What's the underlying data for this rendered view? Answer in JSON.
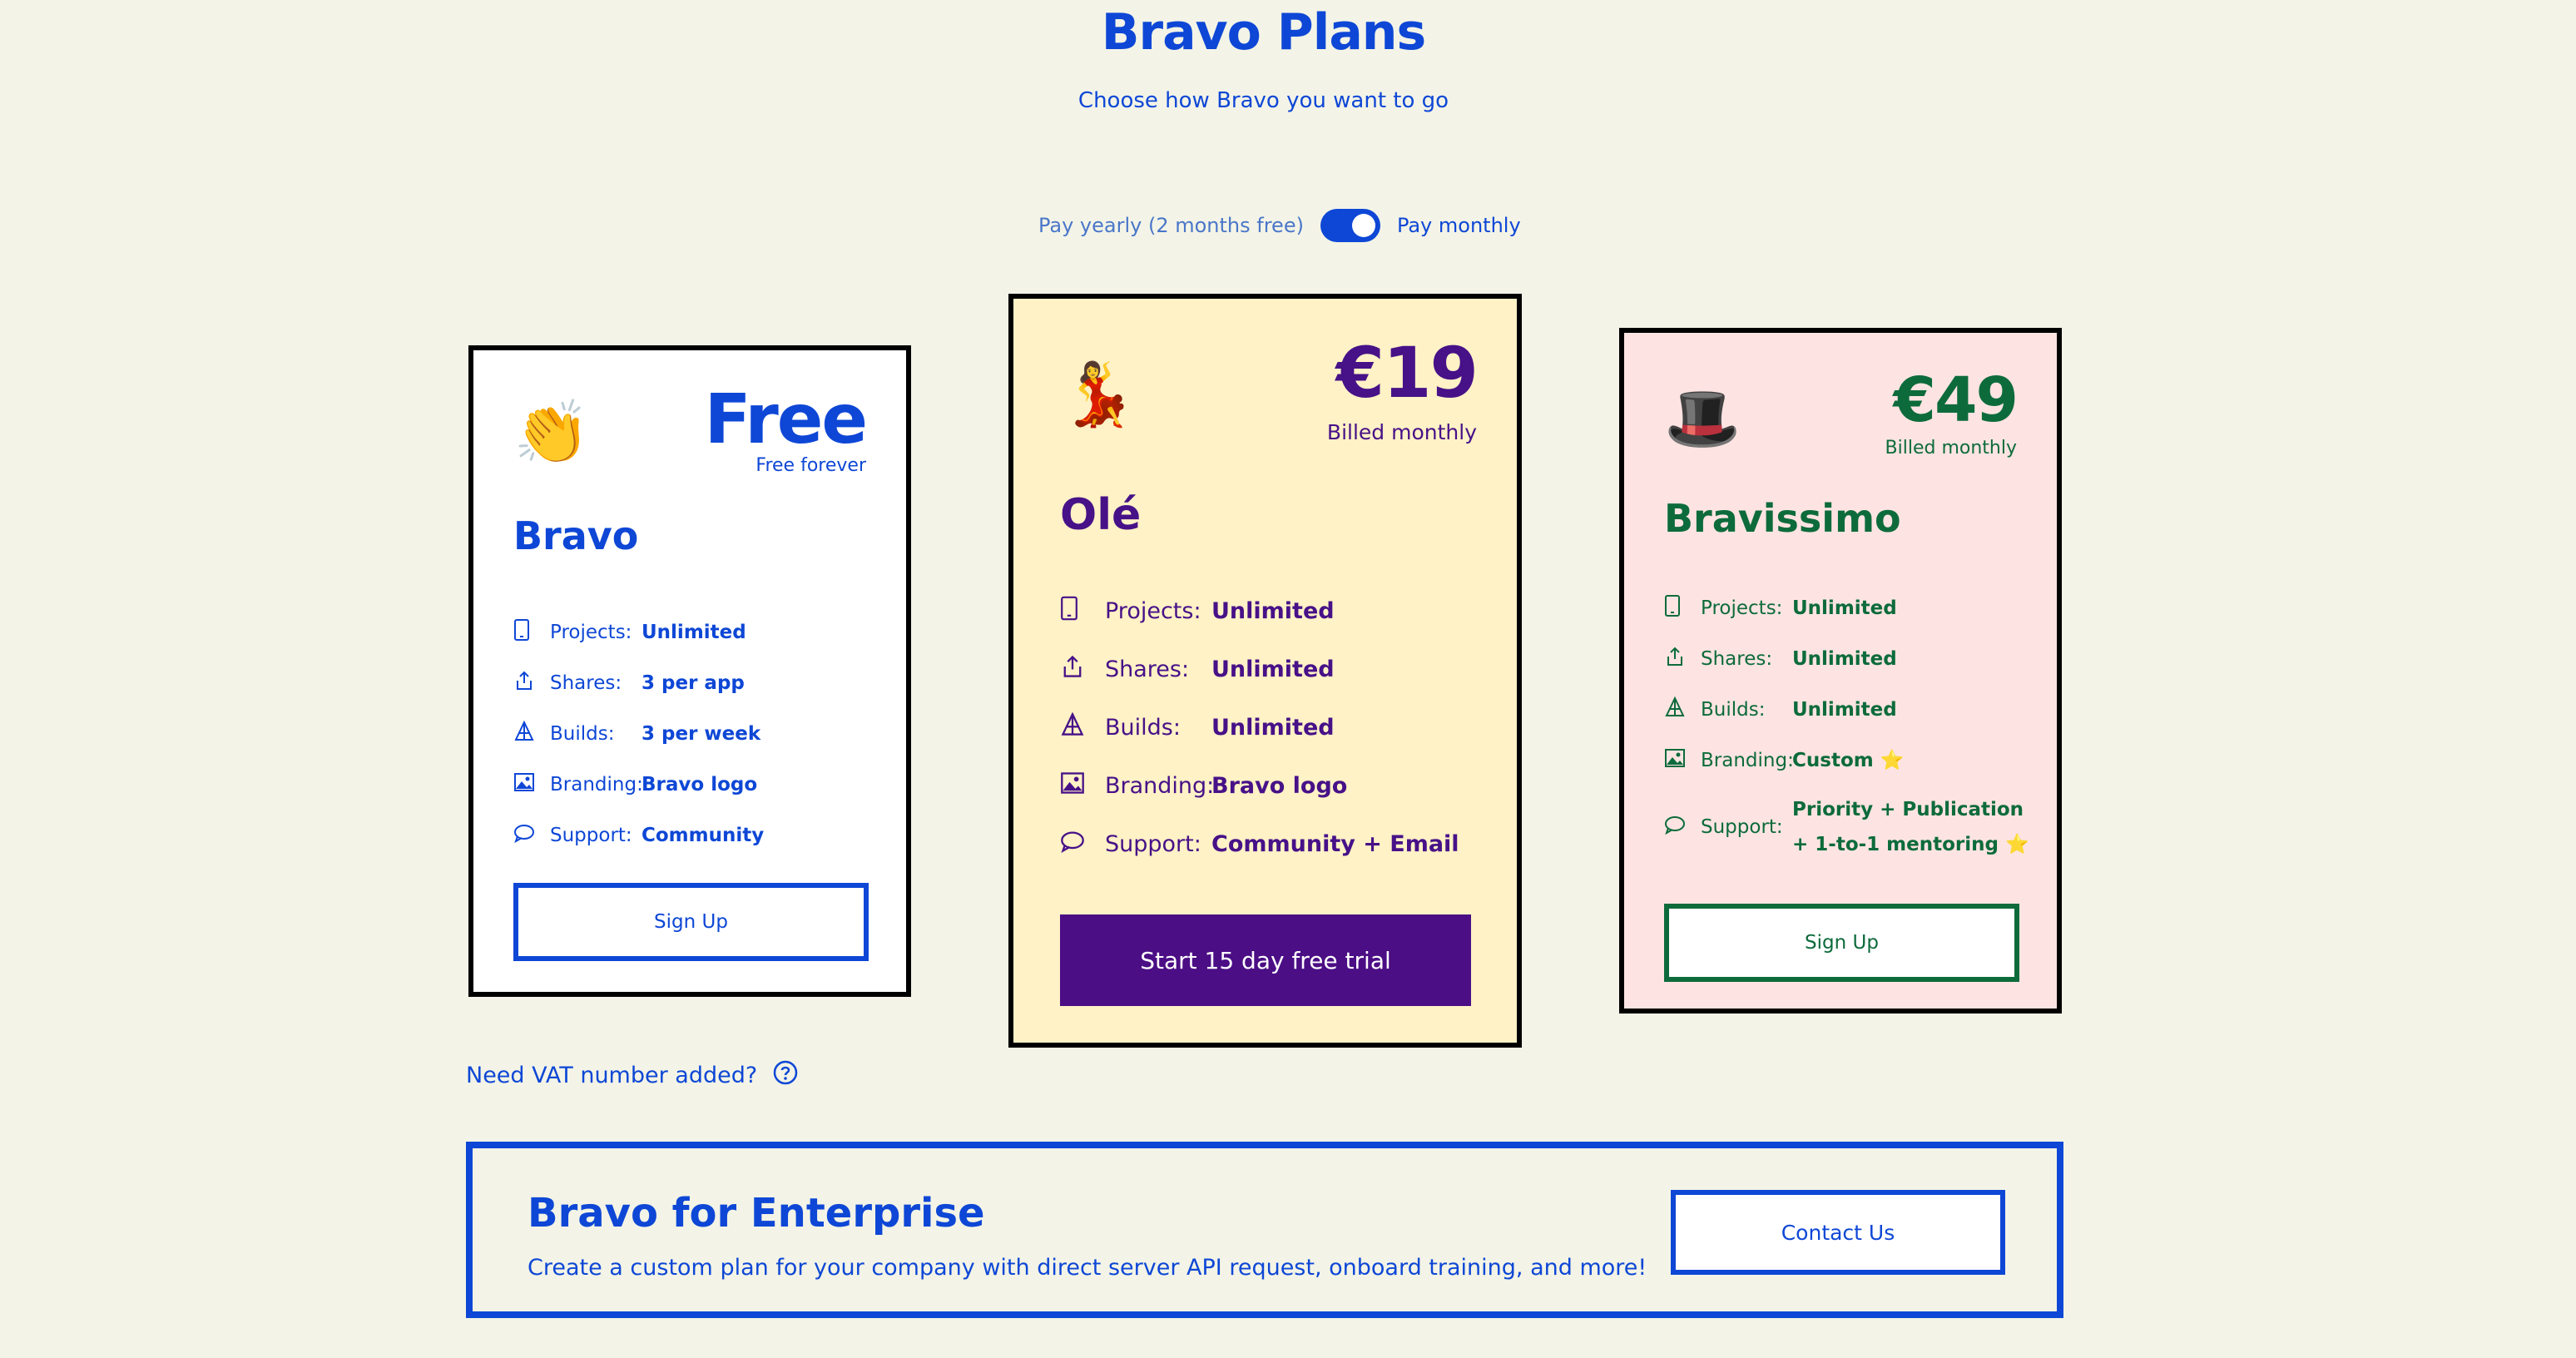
{
  "page": {
    "title": "Bravo Plans",
    "subtitle": "Choose how Bravo you want to go"
  },
  "billing": {
    "yearly_label": "Pay yearly (2 months free)",
    "monthly_label": "Pay monthly",
    "selected": "monthly"
  },
  "plans": [
    {
      "emoji": "👏",
      "price": "Free",
      "price_note": "Free forever",
      "name": "Bravo",
      "features": [
        {
          "icon": "phone-icon",
          "label": "Projects:",
          "value": "Unlimited"
        },
        {
          "icon": "share-icon",
          "label": "Shares:",
          "value": "3 per app"
        },
        {
          "icon": "build-icon",
          "label": "Builds:",
          "value": "3 per week"
        },
        {
          "icon": "image-icon",
          "label": "Branding:",
          "value": "Bravo logo"
        },
        {
          "icon": "chat-icon",
          "label": "Support:",
          "value": "Community"
        }
      ],
      "cta": "Sign Up",
      "colors": {
        "accent": "#0e47d6",
        "background": "#ffffff"
      }
    },
    {
      "emoji": "💃",
      "price": "€19",
      "price_note": "Billed monthly",
      "name": "Olé",
      "features": [
        {
          "icon": "phone-icon",
          "label": "Projects:",
          "value": "Unlimited"
        },
        {
          "icon": "share-icon",
          "label": "Shares:",
          "value": "Unlimited"
        },
        {
          "icon": "build-icon",
          "label": "Builds:",
          "value": "Unlimited"
        },
        {
          "icon": "image-icon",
          "label": "Branding:",
          "value": "Bravo logo"
        },
        {
          "icon": "chat-icon",
          "label": "Support:",
          "value": "Community + Email"
        }
      ],
      "cta": "Start 15 day free trial",
      "colors": {
        "accent": "#471188",
        "background": "#fef2c6",
        "button": "#4b0e85"
      }
    },
    {
      "emoji": "🎩",
      "price": "€49",
      "price_note": "Billed monthly",
      "name": "Bravissimo",
      "features": [
        {
          "icon": "phone-icon",
          "label": "Projects:",
          "value": "Unlimited"
        },
        {
          "icon": "share-icon",
          "label": "Shares:",
          "value": "Unlimited"
        },
        {
          "icon": "build-icon",
          "label": "Builds:",
          "value": "Unlimited"
        },
        {
          "icon": "image-icon",
          "label": "Branding:",
          "value": "Custom ⭐"
        },
        {
          "icon": "chat-icon",
          "label": "Support:",
          "value": "Priority + Publication + 1-to-1 mentoring ⭐"
        }
      ],
      "cta": "Sign Up",
      "colors": {
        "accent": "#0d6b3b",
        "background": "#fde4e2"
      }
    }
  ],
  "vat": {
    "label": "Need VAT number added?",
    "icon": "help-circle-icon"
  },
  "enterprise": {
    "title": "Bravo for Enterprise",
    "description": "Create a custom plan for your company with direct server API request, onboard training, and more!",
    "cta": "Contact Us"
  }
}
